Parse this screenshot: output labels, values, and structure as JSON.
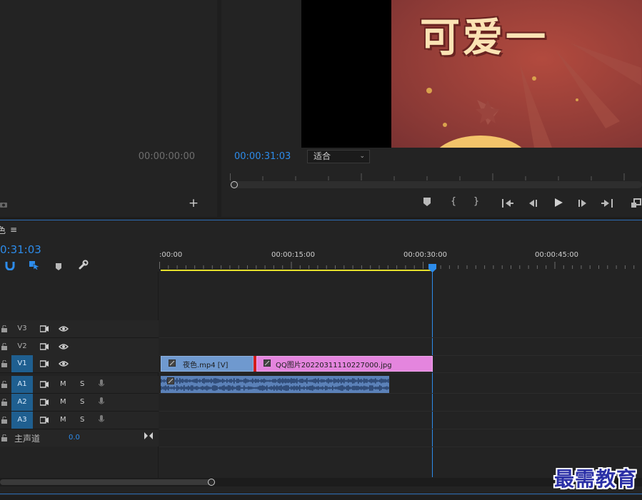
{
  "source_monitor": {
    "timecode": "00:00:00:00",
    "camera_icon": "camera-icon",
    "add_icon": "plus-icon"
  },
  "program_monitor": {
    "preview_text": "可爱一",
    "timecode": "00:00:31:03",
    "fit_select": "适合",
    "controls": [
      "marker-icon",
      "mark-in-icon",
      "mark-out-icon",
      "go-to-in-icon",
      "step-back-icon",
      "play-icon",
      "step-forward-icon",
      "go-to-out-icon",
      "export-frame-icon"
    ]
  },
  "timeline": {
    "tab_fragment": "色",
    "menu_icon": "≡",
    "timecode": "0:31:03",
    "ruler_labels": [
      ":00:00",
      "00:00:15:00",
      "00:00:30:00",
      "00:00:45:00"
    ],
    "tracks": [
      {
        "name": "V3",
        "type": "video",
        "targeted": false
      },
      {
        "name": "V2",
        "type": "video",
        "targeted": false
      },
      {
        "name": "V1",
        "type": "video",
        "targeted": true
      },
      {
        "name": "A1",
        "type": "audio",
        "targeted": true
      },
      {
        "name": "A2",
        "type": "audio",
        "targeted": true
      },
      {
        "name": "A3",
        "type": "audio",
        "targeted": true
      }
    ],
    "audio_buttons": {
      "mute": "M",
      "solo": "S"
    },
    "master": {
      "label": "主声道",
      "value": "0.0"
    },
    "clips": {
      "video1": "夜色.mp4 [V]",
      "video2": "QQ图片20220311110227000.jpg"
    },
    "playhead_time": "00:00:31:03",
    "video_clip1_color": "#6f99cf",
    "video_clip2_color": "#e485de",
    "audio_clip_color": "#5b81b8"
  },
  "watermark": "最需教育"
}
